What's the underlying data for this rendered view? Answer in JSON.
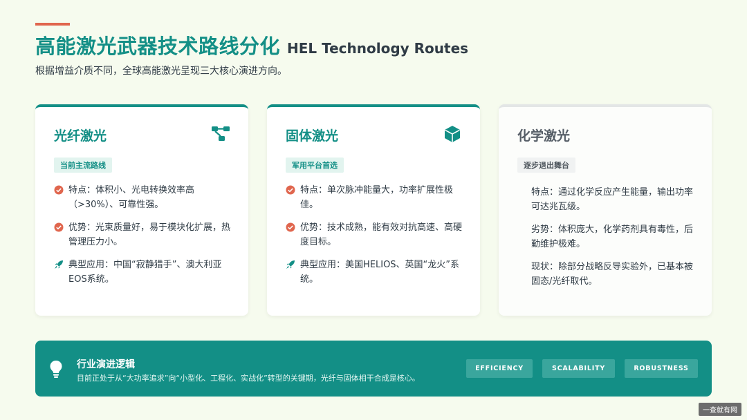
{
  "header": {
    "title_cn": "高能激光武器技术路线分化",
    "title_en": "HEL Technology Routes",
    "subtitle": "根据增益介质不同，全球高能激光呈现三大核心演进方向。"
  },
  "cards": [
    {
      "title": "光纤激光",
      "icon": "network-icon",
      "badge": "当前主流路线",
      "items": [
        {
          "icon": "check-icon",
          "text": "特点：体积小、光电转换效率高（>30%）、可靠性强。"
        },
        {
          "icon": "check-icon",
          "text": "优势：光束质量好，易于模块化扩展，热管理压力小。"
        },
        {
          "icon": "rocket-icon",
          "text": "典型应用：中国“寂静猎手”、澳大利亚EOS系统。"
        }
      ]
    },
    {
      "title": "固体激光",
      "icon": "cube-icon",
      "badge": "军用平台首选",
      "items": [
        {
          "icon": "check-icon",
          "text": "特点：单次脉冲能量大，功率扩展性极佳。"
        },
        {
          "icon": "check-icon",
          "text": "优势：技术成熟，能有效对抗高速、高硬度目标。"
        },
        {
          "icon": "rocket-icon",
          "text": "典型应用：美国HELIOS、英国“龙火”系统。"
        }
      ]
    },
    {
      "title": "化学激光",
      "badge": "逐步退出舞台",
      "items": [
        {
          "text": "特点：通过化学反应产生能量，输出功率可达兆瓦级。"
        },
        {
          "text": "劣势：体积庞大，化学药剂具有毒性，后勤维护极难。"
        },
        {
          "text": "现状：除部分战略反导实验外，已基本被固态/光纤取代。"
        }
      ]
    }
  ],
  "bottom": {
    "icon": "lightbulb-icon",
    "title": "行业演进逻辑",
    "desc": "目前正处于从“大功率追求”向“小型化、工程化、实战化”转型的关键期，光纤与固体相干合成是核心。",
    "tags": [
      "EFFICIENCY",
      "SCALABILITY",
      "ROBUSTNESS"
    ]
  },
  "watermark": "一查就有网",
  "colors": {
    "primary": "#138f86",
    "accent": "#e0664e",
    "background": "#f6fbee"
  }
}
